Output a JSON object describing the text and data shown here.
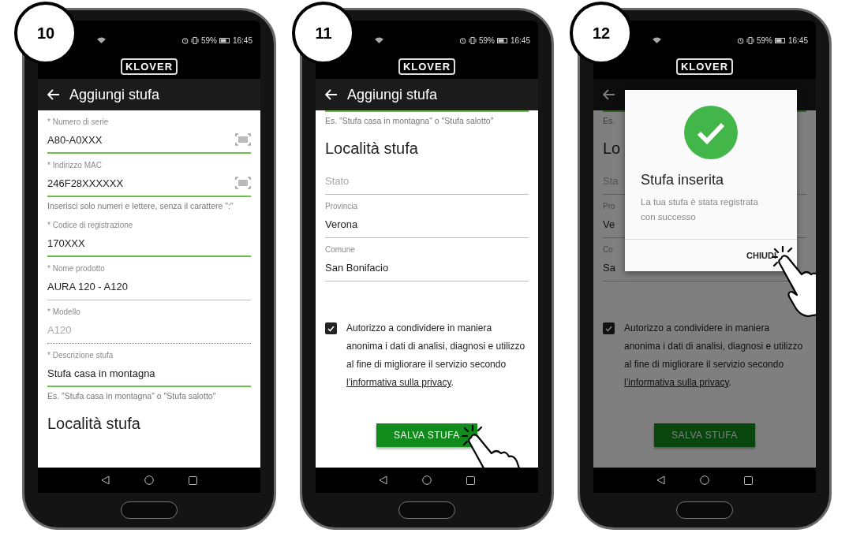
{
  "steps": [
    {
      "number": "10",
      "status": {
        "battery": "59%",
        "time": "16:45"
      },
      "logo": "KLOVER",
      "title": "Aggiungi stufa",
      "dimmed": false,
      "blocks": [
        {
          "kind": "field",
          "label": "* Numero di serie",
          "value": "A80-A0XXX",
          "focused": true,
          "disabled": false,
          "scan": true
        },
        {
          "kind": "field",
          "label": "* Indirizzo MAC",
          "value": "246F28XXXXXX",
          "focused": true,
          "disabled": false,
          "scan": true
        },
        {
          "kind": "hint",
          "text": "Inserisci solo numeri e lettere, senza il carattere \":\""
        },
        {
          "kind": "field",
          "label": "* Codice di registrazione",
          "value": "170XXX",
          "focused": true,
          "disabled": false,
          "scan": false
        },
        {
          "kind": "field",
          "label": "* Nome prodotto",
          "value": "AURA 120 - A120",
          "focused": false,
          "disabled": false,
          "scan": false
        },
        {
          "kind": "field",
          "label": "* Modello",
          "value": "A120",
          "focused": false,
          "disabled": true,
          "scan": false
        },
        {
          "kind": "field",
          "label": "* Descrizione stufa",
          "value": "Stufa casa in montagna",
          "focused": true,
          "disabled": false,
          "scan": false
        },
        {
          "kind": "hint",
          "text": "Es. \"Stufa casa in montagna\" o \"Stufa salotto\""
        },
        {
          "kind": "heading",
          "text": "Località stufa"
        }
      ]
    },
    {
      "number": "11",
      "status": {
        "battery": "59%",
        "time": "16:45"
      },
      "logo": "KLOVER",
      "title": "Aggiungi stufa",
      "dimmed": false,
      "blocks": [
        {
          "kind": "underline",
          "focused": true
        },
        {
          "kind": "hint",
          "text": "Es. \"Stufa casa in montagna\" o \"Stufa salotto\""
        },
        {
          "kind": "heading",
          "text": "Località stufa"
        },
        {
          "kind": "field",
          "placeholder": "Stato",
          "focused": false,
          "disabled": false,
          "scan": false
        },
        {
          "kind": "field",
          "label": "Provincia",
          "value": "Verona",
          "focused": false,
          "disabled": false,
          "scan": false
        },
        {
          "kind": "field",
          "label": "Comune",
          "value": "San Bonifacio",
          "focused": false,
          "disabled": false,
          "scan": false
        },
        {
          "kind": "consent",
          "checked": true,
          "text": "Autorizzo a condividere in maniera anonima i dati di analisi, diagnosi e utilizzo al fine di migliorare il servizio secondo",
          "link": "l’informativa sulla privacy",
          "after": "."
        },
        {
          "kind": "button",
          "label": "SALVA STUFA",
          "tap": true
        }
      ]
    },
    {
      "number": "12",
      "status": {
        "battery": "59%",
        "time": "16:45"
      },
      "logo": "KLOVER",
      "dimmed": true,
      "blocks": [
        {
          "kind": "underline",
          "focused": true
        },
        {
          "kind": "hint",
          "text": "Es."
        },
        {
          "kind": "heading",
          "text": "Lo"
        },
        {
          "kind": "field",
          "placeholder": "Sta",
          "focused": false,
          "disabled": false,
          "scan": false
        },
        {
          "kind": "field",
          "label": "Pro",
          "value": "Ve",
          "focused": false,
          "disabled": false,
          "scan": false
        },
        {
          "kind": "field",
          "label": "Co",
          "value": "Sa",
          "focused": false,
          "disabled": false,
          "scan": false
        },
        {
          "kind": "consent",
          "checked": true,
          "text": "Autorizzo a condividere in maniera anonima i dati di analisi, diagnosi e utilizzo al fine di migliorare il servizio secondo",
          "link": "l’informativa sulla privacy",
          "after": "."
        },
        {
          "kind": "button",
          "label": "SALVA STUFA",
          "tap": false
        }
      ],
      "dialog": {
        "title": "Stufa inserita",
        "message": "La tua stufa è stata registrata con successo",
        "action": "CHIUDI",
        "tap": true
      }
    }
  ]
}
